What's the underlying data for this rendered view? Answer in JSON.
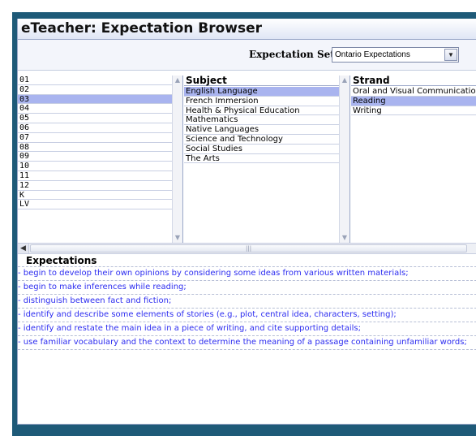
{
  "window": {
    "title": "eTeacher: Expectation Browser"
  },
  "expectation_set": {
    "label": "Expectation Set:",
    "selected": "Ontario Expectations",
    "dropdown_icon": "chevron-down-icon"
  },
  "grades": {
    "items": [
      "01",
      "02",
      "03",
      "04",
      "05",
      "06",
      "07",
      "08",
      "09",
      "10",
      "11",
      "12",
      "K",
      "LV"
    ],
    "selected": "03"
  },
  "subjects": {
    "header": "Subject",
    "items": [
      "English Language",
      "French Immersion",
      "Health & Physical Education",
      "Mathematics",
      "Native Languages",
      "Science and Technology",
      "Social Studies",
      "The Arts"
    ],
    "selected": "English Language"
  },
  "strands": {
    "header": "Strand",
    "items": [
      "Oral and Visual Communication",
      "Reading",
      "Writing"
    ],
    "selected": "Reading"
  },
  "scroll": {
    "up_icon": "scroll-up-icon",
    "down_icon": "scroll-down-icon",
    "left_icon": "scroll-left-icon"
  },
  "expectations": {
    "header": "Expectations",
    "items": [
      "- begin to develop their own opinions by considering some ideas from various written materials;",
      "- begin to make inferences while reading;",
      "- distinguish between fact and fiction;",
      "- identify and describe some elements of stories (e.g., plot, central idea, characters, setting);",
      "- identify and restate the main idea in a piece of writing, and cite supporting details;",
      "- use familiar vocabulary and the context to determine the meaning of a passage containing unfamiliar words;"
    ]
  },
  "colors": {
    "frame": "#1e5a78",
    "selection": "#a9b4ef",
    "link": "#2d2df0"
  }
}
